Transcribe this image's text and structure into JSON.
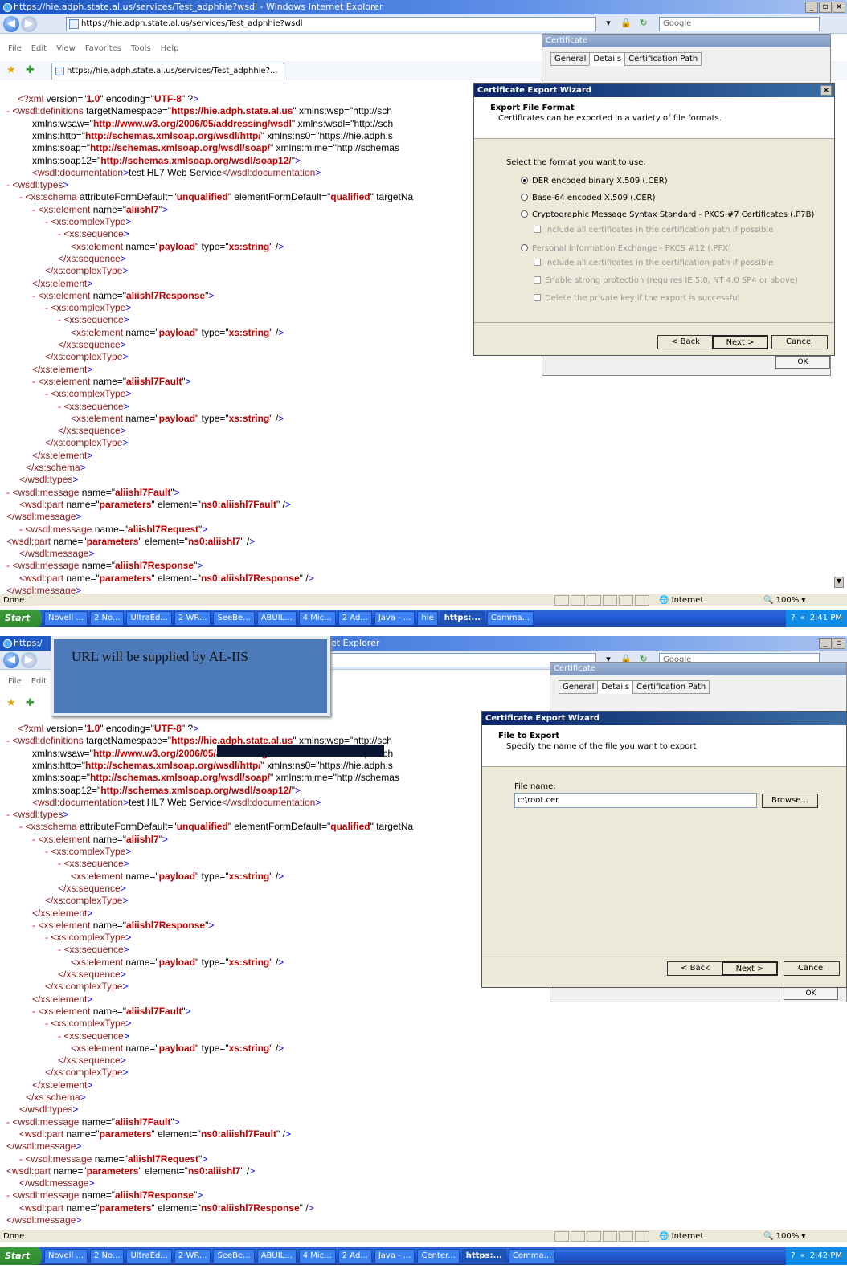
{
  "browser": {
    "title": "https://hie.adph.state.al.us/services/Test_adphhie?wsdl - Windows Internet Explorer",
    "title2_visible": "https:/",
    "title2_suffix": "et Explorer",
    "address": "https://hie.adph.state.al.us/services/Test_adphhie?wsdl",
    "search_placeholder": "Google",
    "menu": [
      "File",
      "Edit",
      "View",
      "Favorites",
      "Tools",
      "Help"
    ],
    "menu2": [
      "File",
      "Edit"
    ],
    "tab_label": "https://hie.adph.state.al.us/services/Test_adphhie?...",
    "status_text": "Done",
    "zone": "Internet",
    "zoom": "100%"
  },
  "xml": [
    "<?xml version=\"1.0\" encoding=\"UTF-8\" ?>",
    "- <wsdl:definitions targetNamespace=\"https://hie.adph.state.al.us\" xmlns:wsp=\"http://sch",
    "xmlns:wsaw=\"http://www.w3.org/2006/05/addressing/wsdl\" xmlns:wsdl=\"http://sch",
    "xmlns:http=\"http://schemas.xmlsoap.org/wsdl/http/\" xmlns:ns0=\"https://hie.adph.s",
    "xmlns:soap=\"http://schemas.xmlsoap.org/wsdl/soap/\" xmlns:mime=\"http://schemas",
    "xmlns:soap12=\"http://schemas.xmlsoap.org/wsdl/soap12/\">",
    "<wsdl:documentation>test HL7 Web Service</wsdl:documentation>",
    "- <wsdl:types>",
    "- <xs:schema attributeFormDefault=\"unqualified\" elementFormDefault=\"qualified\" targetNa",
    "- <xs:element name=\"aliishl7\">",
    "- <xs:complexType>",
    "- <xs:sequence>",
    "<xs:element name=\"payload\" type=\"xs:string\" />",
    "</xs:sequence>",
    "</xs:complexType>",
    "</xs:element>",
    "- <xs:element name=\"aliishl7Response\">",
    "- <xs:complexType>",
    "- <xs:sequence>",
    "<xs:element name=\"payload\" type=\"xs:string\" />",
    "</xs:sequence>",
    "</xs:complexType>",
    "</xs:element>",
    "- <xs:element name=\"aliishl7Fault\">",
    "- <xs:complexType>",
    "- <xs:sequence>",
    "<xs:element name=\"payload\" type=\"xs:string\" />",
    "</xs:sequence>",
    "</xs:complexType>",
    "</xs:element>",
    "</xs:schema>",
    "</wsdl:types>",
    "- <wsdl:message name=\"aliishl7Fault\">",
    "<wsdl:part name=\"parameters\" element=\"ns0:aliishl7Fault\" />",
    "</wsdl:message>",
    "- <wsdl:message name=\"aliishl7Request\">",
    "<wsdl:part name=\"parameters\" element=\"ns0:aliishl7\" />",
    "</wsdl:message>",
    "- <wsdl:message name=\"aliishl7Response\">",
    "<wsdl:part name=\"parameters\" element=\"ns0:aliishl7Response\" />",
    "</wsdl:message>"
  ],
  "xml2_line2": "xmlns:wsaw=\"http://www.w3.org/2",
  "xml2_line2_tail": "s:wsdl=\"http://sch",
  "xml2_line1_tail": "xmlns:wsp=\"http://sch",
  "certificate": {
    "title": "Certificate",
    "tabs": [
      "General",
      "Details",
      "Certification Path"
    ],
    "ok": "OK"
  },
  "wizard1": {
    "title": "Certificate Export Wizard",
    "heading": "Export File Format",
    "subheading": "Certificates can be exported in a variety of file formats.",
    "prompt": "Select the format you want to use:",
    "options": [
      "DER encoded binary X.509 (.CER)",
      "Base-64 encoded X.509 (.CER)",
      "Cryptographic Message Syntax Standard - PKCS #7 Certificates (.P7B)",
      "Include all certificates in the certification path if possible",
      "Personal Information Exchange - PKCS #12 (.PFX)",
      "Include all certificates in the certification path if possible",
      "Enable strong protection (requires IE 5.0, NT 4.0 SP4 or above)",
      "Delete the private key if the export is successful"
    ],
    "back": "< Back",
    "next": "Next >",
    "cancel": "Cancel"
  },
  "wizard2": {
    "title": "Certificate Export Wizard",
    "heading": "File to Export",
    "subheading": "Specify the name of the file you want to export",
    "file_label": "File name:",
    "file_value": "c:\\root.cer",
    "browse": "Browse...",
    "back": "< Back",
    "next": "Next >",
    "cancel": "Cancel"
  },
  "callout": "URL will be supplied by AL-IIS",
  "taskbar": {
    "start": "Start",
    "items": [
      "Novell ...",
      "2 No...",
      "UltraEd...",
      "2 WR...",
      "SeeBe...",
      "ABUIL...",
      "4 Mic...",
      "2 Ad...",
      "Java - ...",
      "hie",
      "https:...",
      "Comma..."
    ],
    "items2": [
      "Novell ...",
      "2 No...",
      "UltraEd...",
      "2 WR...",
      "SeeBe...",
      "ABUIL...",
      "4 Mic...",
      "2 Ad...",
      "Java - ...",
      "Center...",
      "https:...",
      "Comma..."
    ],
    "time1": "2:41 PM",
    "time2": "2:42 PM"
  }
}
